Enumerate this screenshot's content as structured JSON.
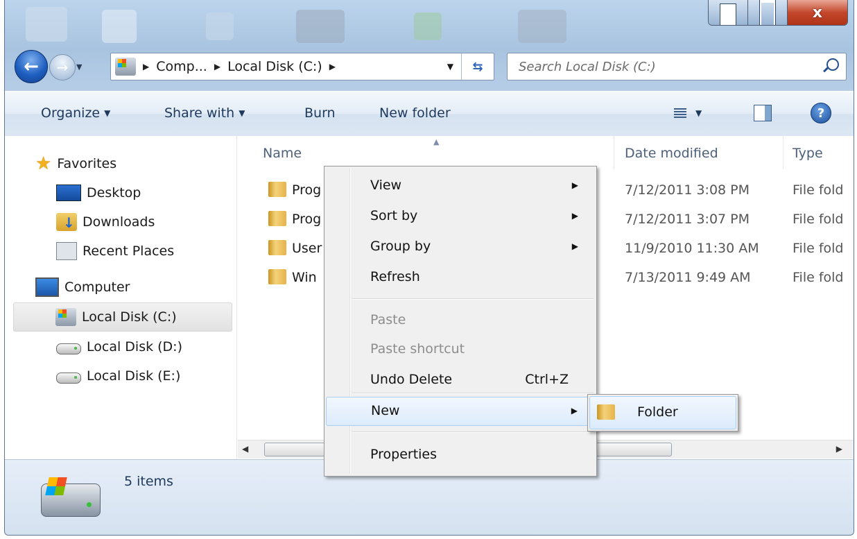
{
  "window": {
    "controls": {
      "close_glyph": "x"
    }
  },
  "navigation": {
    "breadcrumbs": [
      "Comp...",
      "Local Disk (C:)"
    ],
    "search_placeholder": "Search Local Disk (C:)"
  },
  "toolbar": {
    "organize": "Organize",
    "share_with": "Share with",
    "burn": "Burn",
    "new_folder": "New folder",
    "help": "?"
  },
  "sidebar": {
    "favorites": {
      "label": "Favorites",
      "items": [
        {
          "label": "Desktop",
          "icon": "desktop-icon"
        },
        {
          "label": "Downloads",
          "icon": "downloads-icon"
        },
        {
          "label": "Recent Places",
          "icon": "recent-places-icon"
        }
      ]
    },
    "computer": {
      "label": "Computer",
      "items": [
        {
          "label": "Local Disk (C:)",
          "icon": "drive-c-icon",
          "selected": true
        },
        {
          "label": "Local Disk (D:)",
          "icon": "drive-icon"
        },
        {
          "label": "Local Disk (E:)",
          "icon": "drive-icon"
        }
      ]
    }
  },
  "file_list": {
    "columns": {
      "name": "Name",
      "date_modified": "Date modified",
      "type": "Type"
    },
    "rows": [
      {
        "name": "Prog",
        "date": "7/12/2011 3:08 PM",
        "type": "File fold"
      },
      {
        "name": "Prog",
        "date": "7/12/2011 3:07 PM",
        "type": "File fold"
      },
      {
        "name": "User",
        "date": "11/9/2010 11:30 AM",
        "type": "File fold"
      },
      {
        "name": "Win",
        "date": "7/13/2011 9:49 AM",
        "type": "File fold"
      }
    ]
  },
  "status": {
    "item_count": "5 items"
  },
  "context_menu": {
    "items": [
      {
        "label": "View",
        "submenu": true
      },
      {
        "label": "Sort by",
        "submenu": true
      },
      {
        "label": "Group by",
        "submenu": true
      },
      {
        "label": "Refresh"
      },
      {
        "label": "Paste",
        "disabled": true
      },
      {
        "label": "Paste shortcut",
        "disabled": true
      },
      {
        "label": "Undo Delete",
        "shortcut": "Ctrl+Z"
      },
      {
        "label": "New",
        "submenu": true,
        "highlighted": true
      },
      {
        "label": "Properties"
      }
    ],
    "submenu_new": {
      "items": [
        {
          "label": "Folder",
          "icon": "folder-icon"
        }
      ]
    }
  },
  "colors": {
    "highlight_border": "#a8cff5",
    "toolbar_text": "#1e395b",
    "close_button": "#c2472b"
  }
}
